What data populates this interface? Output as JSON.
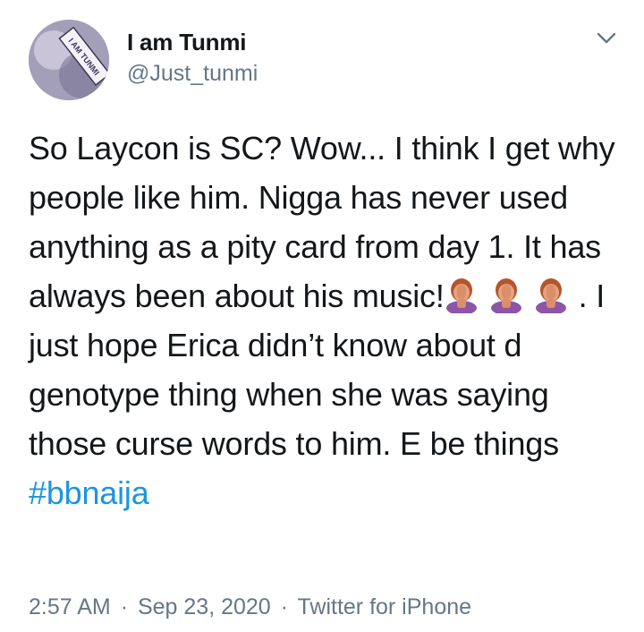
{
  "tweet": {
    "display_name": "I am Tunmi",
    "handle": "@Just_tunmi",
    "avatar_text": "I AM TUNMI",
    "menu_icon": "chevron-down-icon",
    "text_part1": "So Laycon is SC? Wow... I think I get why people like him. Nigga has never used anything as a pity card from day 1. It has always been about his music!",
    "emojis": [
      "facepalm-emoji",
      "facepalm-emoji",
      "facepalm-emoji"
    ],
    "text_part2": ". I just hope Erica didn’t know about d genotype thing when she was saying those curse words to him. E be things ",
    "hashtag": "#bbnaija",
    "time": "2:57 AM",
    "separator": "·",
    "date": "Sep 23, 2020",
    "source": "Twitter for iPhone"
  },
  "colors": {
    "text": "#14171a",
    "secondary": "#657786",
    "link": "#1b95e0",
    "background": "#ffffff"
  }
}
